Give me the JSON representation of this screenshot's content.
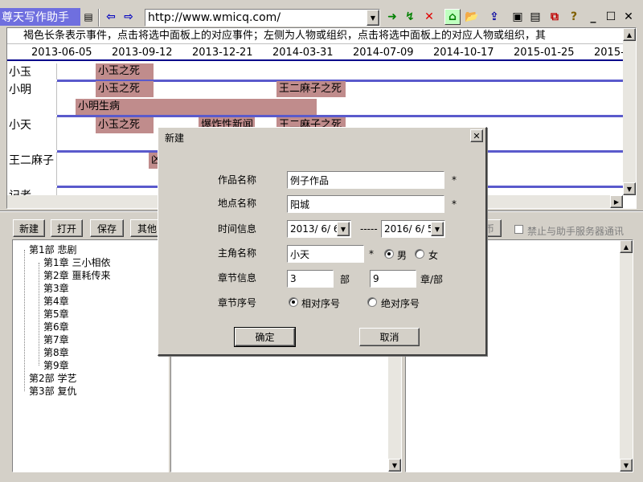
{
  "app": {
    "title": "尊天写作助手"
  },
  "toolbar": {
    "url": "http://www.wmicq.com/",
    "icons": [
      "doc-icon",
      "back-icon",
      "forward-icon",
      "go-icon",
      "refresh-icon",
      "stop-icon",
      "home-icon",
      "open-icon",
      "upload-icon",
      "window-icon",
      "page-icon",
      "export-icon",
      "help-icon",
      "minimize-icon",
      "maximize-icon",
      "close-icon"
    ]
  },
  "timeline": {
    "description": "褐色长条表示事件，点击将选中面板上的对应事件；左侧为人物或组织，点击将选中面板上的对应人物或组织，其",
    "dates": [
      "2013-06-05",
      "2013-09-12",
      "2013-12-21",
      "2014-03-31",
      "2014-07-09",
      "2014-10-17",
      "2015-01-25",
      "2015-"
    ],
    "rows": [
      "小玉",
      "小明",
      "小天",
      "王二麻子",
      "记者"
    ],
    "events": [
      "小玉之死",
      "小玉之死",
      "王二麻子之死",
      "小明生病",
      "小玉之死",
      "爆炸性新闻",
      "王二麻子之死",
      "凶"
    ]
  },
  "buttons": {
    "new": "新建",
    "open": "打开",
    "save": "保存",
    "other": "其他",
    "f": "币"
  },
  "checkbox_label": "禁止与助手服务器通讯",
  "tree": {
    "part1": "第1部 悲剧",
    "chapters": [
      "第1章 三小相依",
      "第2章 噩耗传来",
      "第3章",
      "第4章",
      "第5章",
      "第6章",
      "第7章",
      "第8章",
      "第9章"
    ],
    "part2": "第2部 学艺",
    "part3": "第3部 复仇"
  },
  "dialog": {
    "title": "新建",
    "work_label": "作品名称",
    "work_value": "例子作品",
    "place_label": "地点名称",
    "place_value": "阳城",
    "time_label": "时间信息",
    "date_start": "2013/ 6/ 6",
    "date_sep": "-----",
    "date_end": "2016/ 6/ 5",
    "hero_label": "主角名称",
    "hero_value": "小天",
    "male": "男",
    "female": "女",
    "chapter_label": "章节信息",
    "parts_value": "3",
    "parts_unit": "部",
    "chapters_value": "9",
    "chapters_unit": "章/部",
    "order_label": "章节序号",
    "relative": "相对序号",
    "absolute": "绝对序号",
    "ok": "确定",
    "cancel": "取消",
    "star": "*"
  }
}
